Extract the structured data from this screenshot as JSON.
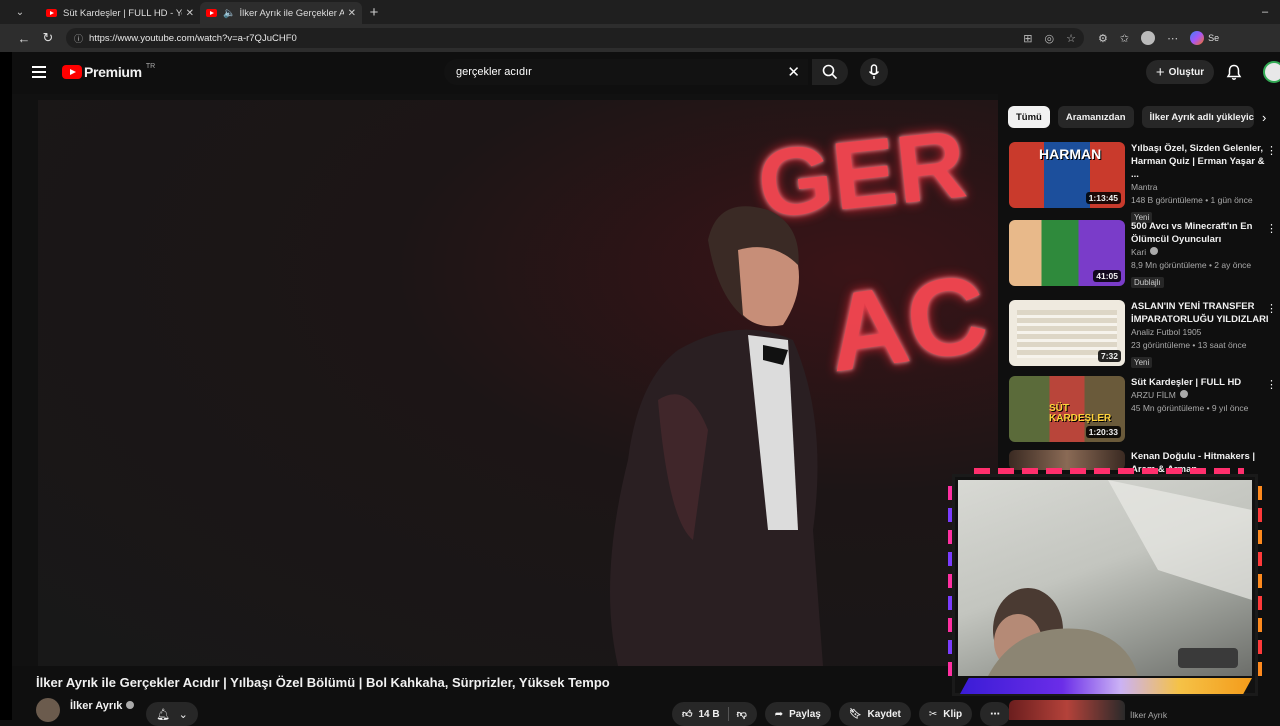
{
  "browser": {
    "tabs": [
      {
        "title": "Süt Kardeşler | FULL HD - YouTube",
        "active": false
      },
      {
        "title": "İlker Ayrık ile Gerçekler Acıdır",
        "active": true
      }
    ],
    "url": "https://www.youtube.com/watch?v=a-r7QJuCHF0",
    "copilot_label": "Se"
  },
  "youtube": {
    "logo_text": "Premium",
    "region": "TR",
    "search_value": "gerçekler acıdır",
    "create_label": "Oluştur"
  },
  "video": {
    "neon_text_1": "GER",
    "neon_text_2": "AC",
    "title": "İlker Ayrık ile Gerçekler Acıdır | Yılbaşı Özel Bölümü | Bol Kahkaha, Sürprizler, Yüksek Tempo",
    "channel": "İlker Ayrık",
    "likes": "14 B",
    "share_label": "Paylaş",
    "save_label": "Kaydet",
    "clip_label": "Klip"
  },
  "chips": [
    "Tümü",
    "Aramanızdan",
    "İlker Ayrık adlı yükleyici"
  ],
  "recommendations": [
    {
      "title": "Yılbaşı Özel, Sizden Gelenler, Harman Quiz | Erman Yaşar & ...",
      "channel": "Mantra",
      "stats": "148 B görüntüleme • 1 gün önce",
      "badge": "Yeni",
      "duration": "1:13:45",
      "thumb_colors": [
        "#c93a2c",
        "#1c4f9c"
      ],
      "thumb_text": "HARMAN"
    },
    {
      "title": "500 Avcı vs Minecraft'ın En Ölümcül Oyuncuları",
      "channel": "Kari",
      "stats": "8,9 Mn görüntüleme • 2 ay önce",
      "badge": "Dublajlı",
      "duration": "41:05",
      "thumb_colors": [
        "#2f8a3c",
        "#7a3cc9"
      ],
      "thumb_text": ""
    },
    {
      "title": "ASLAN'IN YENİ TRANSFER İMPARATORLUĞU YILDIZLARI",
      "channel": "Analiz Futbol 1905",
      "stats": "23 görüntüleme • 13 saat önce",
      "badge": "Yeni",
      "duration": "7:32",
      "thumb_colors": [
        "#f2efe6",
        "#d9d3c4"
      ],
      "thumb_text": ""
    },
    {
      "title": "Süt Kardeşler | FULL HD",
      "channel": "ARZU FİLM",
      "stats": "45 Mn görüntüleme • 9 yıl önce",
      "badge": "",
      "duration": "1:20:33",
      "thumb_colors": [
        "#5b6b3a",
        "#b9453a"
      ],
      "thumb_text": "SÜT KARDEŞLER"
    },
    {
      "title": "Kenan Doğulu - Hitmakers | Arem & Arman",
      "channel": "",
      "stats": "",
      "badge": "",
      "duration": "",
      "thumb_colors": [
        "#3a2a22",
        "#8a6a55"
      ],
      "thumb_text": ""
    }
  ],
  "bottom_peek_channel": "İlker Ayrık"
}
